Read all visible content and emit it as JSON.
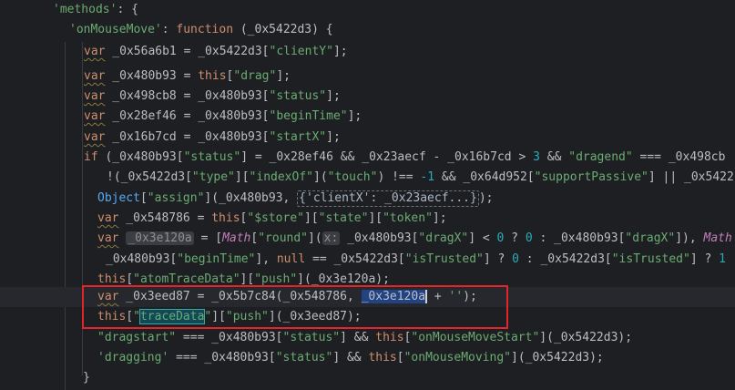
{
  "code": {
    "l0": [
      "'methods'",
      ": {"
    ],
    "l1": [
      "'onMouseMove'",
      ": ",
      "function",
      " (_0x5422d3) {"
    ],
    "l2": [
      "var",
      " _0x56a6b1 = _0x5422d3[",
      "\"clientY\"",
      "];"
    ],
    "l3": [
      "var",
      " _0x480b93 = ",
      "this",
      "[",
      "\"drag\"",
      "];"
    ],
    "l4": [
      "var",
      " _0x498cb8 = _0x480b93[",
      "\"status\"",
      "];"
    ],
    "l5": [
      "var",
      " _0x28ef46 = _0x480b93[",
      "\"beginTime\"",
      "];"
    ],
    "l6": [
      "var",
      " _0x16b7cd = _0x480b93[",
      "\"startX\"",
      "];"
    ],
    "l7": [
      "if",
      " (_0x480b93[",
      "\"status\"",
      "] = _0x28ef46 && _0x23aecf - _0x16b7cd > ",
      "3",
      " && ",
      "\"dragend\"",
      " === _0x498cb"
    ],
    "l8": [
      "!(_0x5422d3[",
      "\"type\"",
      "][",
      "\"indexOf\"",
      "](",
      "\"touch\"",
      ") !== ",
      "-1",
      " && _0x64d952[",
      "\"supportPassive\"",
      "] || _0x5422"
    ],
    "l9": [
      "Object",
      "[",
      "\"assign\"",
      "](_0x480b93, ",
      "{'clientX': _0x23aecf...}",
      ");"
    ],
    "l10": [
      "var",
      " _0x548786 = ",
      "this",
      "[",
      "\"$store\"",
      "][",
      "\"state\"",
      "][",
      "\"token\"",
      "];"
    ],
    "l11": [
      "var",
      " ",
      "_0x3e120a",
      " = [",
      "Math",
      "[",
      "\"round\"",
      "](",
      "x:",
      " _0x480b93[",
      "\"dragX\"",
      "] < ",
      "0",
      " ? ",
      "0",
      " : _0x480b93[",
      "\"dragX\"",
      "]), ",
      "Math"
    ],
    "l12": [
      "_0x480b93[",
      "\"beginTime\"",
      "], ",
      "null",
      " == _0x5422d3[",
      "\"isTrusted\"",
      "] ? ",
      "0",
      " : _0x5422d3[",
      "\"isTrusted\"",
      "] ? ",
      "1"
    ],
    "l13": [
      "this",
      "[",
      "\"atomTraceData\"",
      "][",
      "\"push\"",
      "](_0x3e120a);"
    ],
    "l14": [
      "var",
      " _0x3eed87 = _0x5b7c84(_0x548786, ",
      "_0x3e120a",
      " + ",
      "''",
      ");"
    ],
    "l15": [
      "this",
      "[",
      "\"",
      "traceData",
      "\"",
      "][",
      "\"push\"",
      "](_0x3eed87);"
    ],
    "l16": [
      "\"dragstart\"",
      " === _0x480b93[",
      "\"status\"",
      "] && ",
      "this",
      "[",
      "\"onMouseMoveStart\"",
      "](_0x5422d3);"
    ],
    "l17": [
      "'dragging'",
      " === _0x480b93[",
      "\"status\"",
      "] && ",
      "this",
      "[",
      "\"onMouseMoving\"",
      "](_0x5422d3);"
    ],
    "l18": [
      "}"
    ]
  },
  "colors": {
    "keyword": "#cf8e6d",
    "string": "#6aab73",
    "property": "#c77dbb",
    "number": "#2aacb8",
    "text": "#bcbec4",
    "highlight_box": "#e0262b"
  }
}
